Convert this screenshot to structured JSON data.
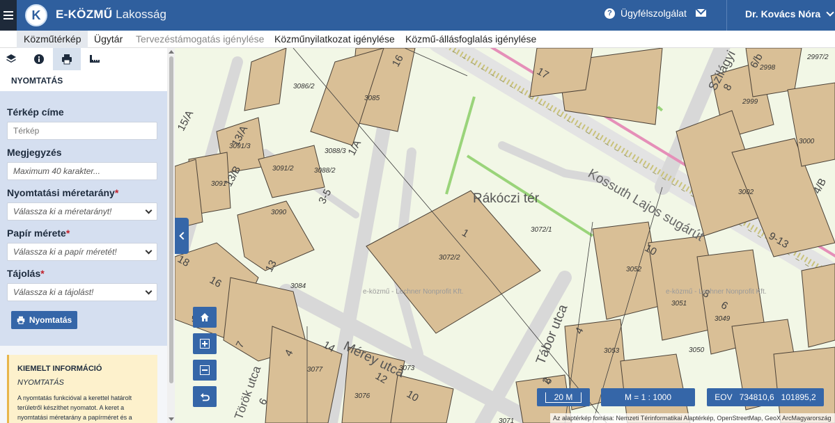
{
  "header": {
    "logo_letter": "K",
    "brand_bold": "E-KÖZMŰ",
    "brand_light": "Lakosság",
    "support_label": "Ügyfélszolgálat",
    "user_name": "Dr. Kovács Nóra"
  },
  "nav": {
    "tabs": [
      {
        "label": "Közműtérkép",
        "active": true
      },
      {
        "label": "Ügytár"
      },
      {
        "label": "Tervezéstámogatás igénylése",
        "muted": true
      },
      {
        "label": "Közműnyilatkozat igénylése"
      },
      {
        "label": "Közmű-állásfoglalás igénylése"
      }
    ]
  },
  "sidebar": {
    "section_title": "NYOMTATÁS",
    "fields": {
      "title_label": "Térkép címe",
      "title_placeholder": "Térkép",
      "note_label": "Megjegyzés",
      "note_placeholder": "Maximum 40 karakter...",
      "scale_label": "Nyomtatási méretarány",
      "scale_value": "Válassza ki a méretarányt!",
      "paper_label": "Papír mérete",
      "paper_value": "Válassza ki a papír méretét!",
      "orient_label": "Tájolás",
      "orient_value": "Válassza ki a tájolást!",
      "required_mark": "*"
    },
    "print_button": "Nyomtatás",
    "info": {
      "heading": "KIEMELT INFORMÁCIÓ",
      "subheading": "NYOMTATÁS",
      "text": "A nyomtatás funkcióval a kerettel határolt területről készíthet nyomatot. A keret a nyomtatási méretarány a papírméret és a"
    }
  },
  "map": {
    "place_name": "Rákóczi tér",
    "streets": {
      "kossuth": "Kossuth Lajos sugárút",
      "merey": "Mérey utca",
      "tabor": "Tábor utca",
      "szilagyi": "Szilágyi",
      "torok": "Török utca"
    },
    "parcels": [
      "3086/2",
      "3085",
      "3091/3",
      "3088/3",
      "3091/2",
      "3088/2",
      "3091",
      "3090",
      "3084",
      "3072/2",
      "3072/1",
      "3077",
      "3076",
      "3073",
      "3071",
      "3052",
      "3051",
      "3049",
      "3053",
      "3050",
      "3002",
      "3000",
      "2999",
      "2998",
      "2997/2"
    ],
    "house_numbers": [
      "16",
      "17",
      "1/A",
      "13/A",
      "13/B",
      "15/A",
      "3-5",
      "13",
      "18",
      "16",
      "7",
      "14",
      "12",
      "10",
      "4",
      "6",
      "1",
      "10",
      "8",
      "6",
      "4",
      "2",
      "8",
      "6/b",
      "9-13",
      "5",
      "6",
      "4/B"
    ],
    "watermark": "e-közmű - Lechner Nonprofit Kft."
  },
  "scale_bar": "20 M",
  "scale_ratio": "M = 1 : 1000",
  "coordinates": {
    "label": "EOV",
    "x": "734810,6",
    "y": "101895,2"
  },
  "attribution": "Az alaptérkép forrása: Nemzeti Térinformatikai Alaptérkép, OpenStreetMap, GeoX ArcMagyarország"
}
